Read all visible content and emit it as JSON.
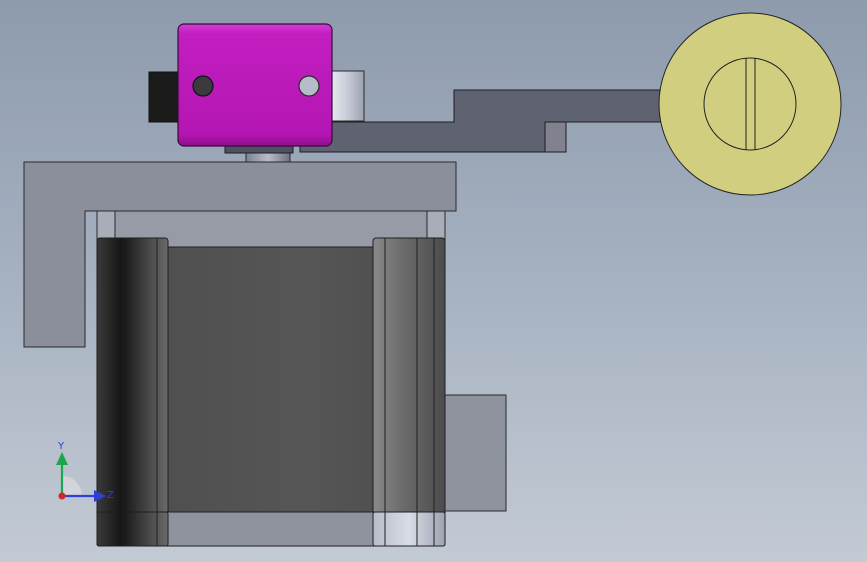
{
  "viewport": {
    "background_top": "#8e9bac",
    "background_bottom": "#c3cad4"
  },
  "model": {
    "bracket_color": "#8b8f9b",
    "motor_body_color": "#4c4d4c",
    "arm_color": "#5f6270",
    "clamp_color": "#c21ec0",
    "wheel_color": "#d1cf7f"
  },
  "triad": {
    "y_label": "Y",
    "z_label": "Z",
    "y_color": "#1aa64a",
    "z_color": "#2e3fd6",
    "origin_color": "#d42424"
  }
}
